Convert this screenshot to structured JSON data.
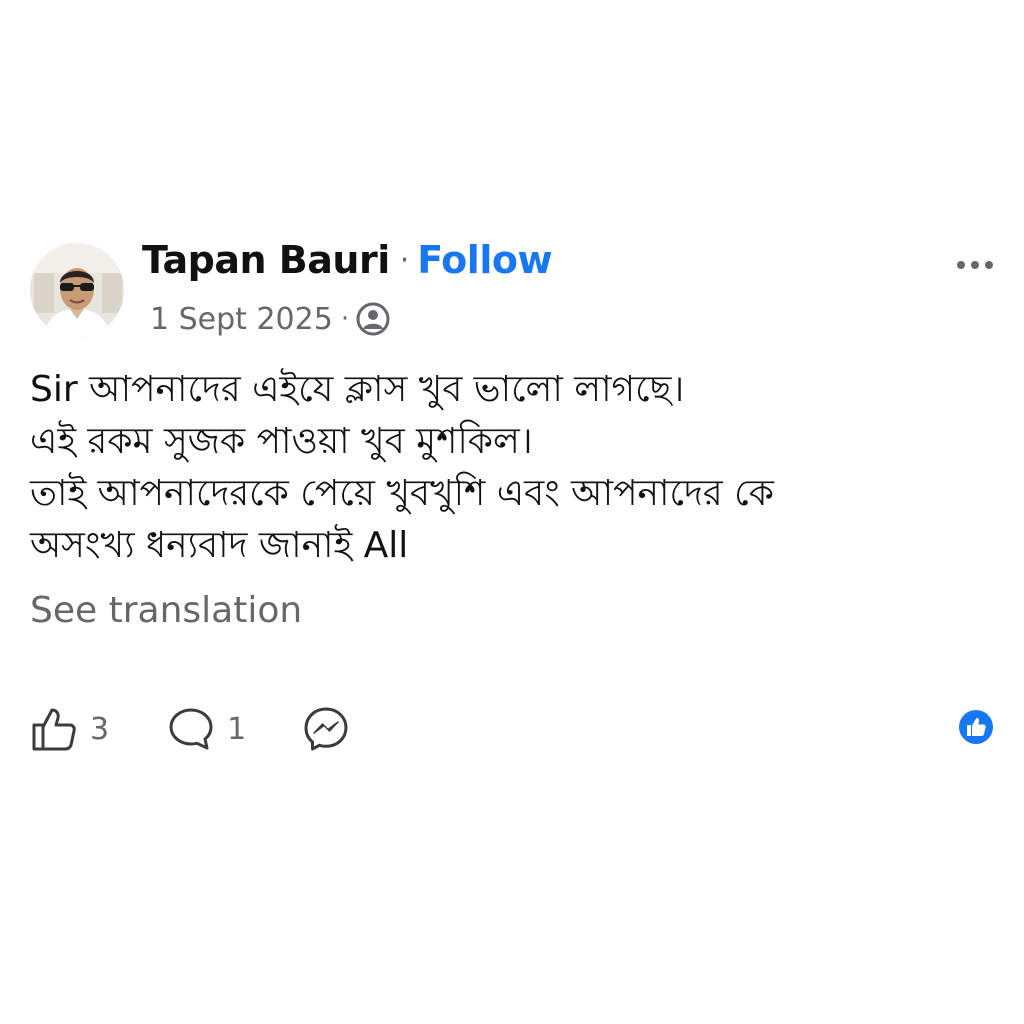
{
  "post": {
    "author": "Tapan Bauri",
    "separator": "·",
    "follow_label": "Follow",
    "date": "1 Sept 2025",
    "meta_separator": "·",
    "audience_icon": "friends-icon",
    "more_icon": "more-options-icon",
    "body_lines": [
      "Sir আপনাদের এইযে ক্লাস খুব ভালো লাগছে।",
      "এই রকম সুজক পাওয়া খুব মুশকিল।",
      "তাই আপনাদেরকে পেয়ে খুবখুশি এবং আপনাদের কে",
      "অসংখ্য ধন্যবাদ জানাই All"
    ],
    "see_translation": "See translation"
  },
  "actions": {
    "like_count": "3",
    "comment_count": "1",
    "like_icon": "thumbs-up-icon",
    "comment_icon": "comment-icon",
    "share_icon": "messenger-icon",
    "reaction_icon": "like-reaction-icon"
  },
  "colors": {
    "brand_blue": "#1877f2",
    "text_primary": "#111111",
    "text_secondary": "#65676b"
  }
}
